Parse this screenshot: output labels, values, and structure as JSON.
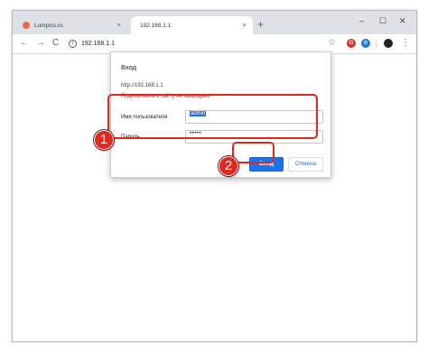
{
  "browser": {
    "tabs": [
      {
        "label": "Lumpics.ru",
        "active": false
      },
      {
        "label": "192.168.1.1",
        "active": true
      }
    ],
    "tab_close_glyph": "×",
    "new_tab_glyph": "+",
    "window_controls": {
      "minimize": "–",
      "maximize": "☐",
      "close": "✕"
    },
    "nav": {
      "back": "←",
      "forward": "→",
      "reload": "C"
    },
    "address": "192.168.1.1",
    "info_glyph": "i",
    "star_glyph": "☆",
    "ext_red_glyph": "G",
    "ext_blue_glyph": "⚙",
    "menu_glyph": "⋮",
    "icons": [
      "lumpics-favicon",
      "info-icon",
      "star-icon",
      "extension-red-icon",
      "extension-blue-icon",
      "avatar",
      "menu-icon"
    ]
  },
  "dialog": {
    "title": "Вход",
    "host": "http://192.168.1.1",
    "warning": "Подключение к сайту не защищено",
    "username_label": "Имя пользователя",
    "username_value": "admin",
    "password_label": "Пароль",
    "password_value": "•••••",
    "login_label": "Вход",
    "cancel_label": "Отмена"
  },
  "annotations": {
    "step1": "1",
    "step2": "2",
    "highlight_color": "#e0281f"
  },
  "colors": {
    "accent": "#1a73e8",
    "warning": "#c5221f",
    "tabstrip": "#dee1e6"
  }
}
